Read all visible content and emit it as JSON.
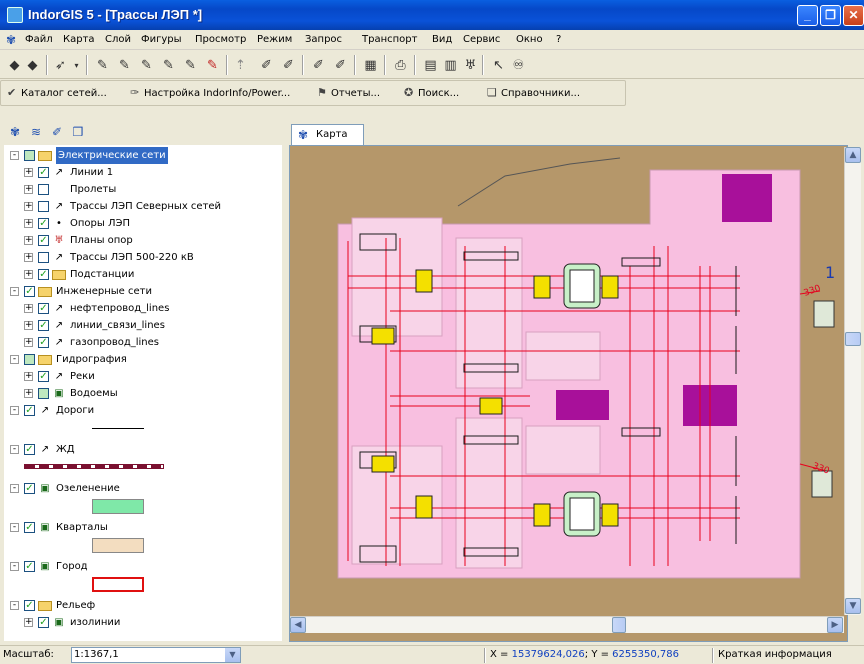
{
  "window": {
    "title": "IndorGIS 5 - [Трассы ЛЭП *]",
    "minimize": "_",
    "restore": "❐",
    "close": "✕"
  },
  "menu": [
    "Файл",
    "Карта",
    "Слой",
    "Фигуры",
    "Просмотр",
    "Режим",
    "Запрос",
    "Транспорт",
    "Вид",
    "Сервис",
    "Окно",
    "?"
  ],
  "mdi_controls": {
    "minimize": "_",
    "restore": "❐",
    "close": "✕"
  },
  "toolbar2": [
    {
      "label": "Каталог сетей...",
      "icon": "checkmark-icon"
    },
    {
      "label": "Настройка IndorInfo/Power...",
      "icon": "wrench-icon"
    },
    {
      "label": "Отчеты...",
      "icon": "report-icon"
    },
    {
      "label": "Поиск...",
      "icon": "search-icon"
    },
    {
      "label": "Справочники...",
      "icon": "book-icon"
    }
  ],
  "map_tab": "Карта",
  "tree": [
    {
      "label": "Электрические сети",
      "level": 0,
      "type": "folder",
      "expand": "-",
      "check": "partial",
      "selected": true
    },
    {
      "label": "Линии 1",
      "level": 1,
      "type": "line",
      "expand": "+",
      "check": "checked"
    },
    {
      "label": "Пролеты",
      "level": 1,
      "type": "none",
      "expand": "+",
      "check": "unchecked"
    },
    {
      "label": "Трассы ЛЭП Северных сетей",
      "level": 1,
      "type": "line",
      "expand": "+",
      "check": "unchecked"
    },
    {
      "label": "Опоры ЛЭП",
      "level": 1,
      "type": "point",
      "expand": "+",
      "check": "checked"
    },
    {
      "label": "Планы опор",
      "level": 1,
      "type": "tower",
      "expand": "+",
      "check": "checked"
    },
    {
      "label": "Трассы ЛЭП 500-220 кВ",
      "level": 1,
      "type": "line",
      "expand": "+",
      "check": "unchecked"
    },
    {
      "label": "Подстанции",
      "level": 1,
      "type": "folder",
      "expand": "+",
      "check": "checked"
    },
    {
      "label": "Инженерные сети",
      "level": 0,
      "type": "folder",
      "expand": "-",
      "check": "checked"
    },
    {
      "label": "нефтепровод_lines",
      "level": 1,
      "type": "line",
      "expand": "+",
      "check": "checked"
    },
    {
      "label": "линии_связи_lines",
      "level": 1,
      "type": "line",
      "expand": "+",
      "check": "checked"
    },
    {
      "label": "газопровод_lines",
      "level": 1,
      "type": "line",
      "expand": "+",
      "check": "checked"
    },
    {
      "label": "Гидрография",
      "level": 0,
      "type": "folder",
      "expand": "-",
      "check": "partial"
    },
    {
      "label": "Реки",
      "level": 1,
      "type": "line",
      "expand": "+",
      "check": "checked"
    },
    {
      "label": "Водоемы",
      "level": 1,
      "type": "poly",
      "expand": "+",
      "check": "partial"
    },
    {
      "label": "Дороги",
      "level": 0,
      "type": "line",
      "expand": "-",
      "check": "checked",
      "swatch": {
        "kind": "line",
        "color": "#000000"
      }
    },
    {
      "label": "ЖД",
      "level": 0,
      "type": "line",
      "expand": "-",
      "check": "checked",
      "swatch": {
        "kind": "rail",
        "color": "#7a1030"
      }
    },
    {
      "label": "Озеленение",
      "level": 0,
      "type": "poly",
      "expand": "-",
      "check": "checked",
      "swatch": {
        "kind": "fill",
        "color": "#7fe8a8"
      }
    },
    {
      "label": "Кварталы",
      "level": 0,
      "type": "poly",
      "expand": "-",
      "check": "checked",
      "swatch": {
        "kind": "fill",
        "color": "#f3ddc0"
      }
    },
    {
      "label": "Город",
      "level": 0,
      "type": "poly",
      "expand": "-",
      "check": "checked",
      "swatch": {
        "kind": "outline",
        "color": "#e01010"
      }
    },
    {
      "label": "Рельеф",
      "level": 0,
      "type": "folder",
      "expand": "-",
      "check": "checked"
    },
    {
      "label": "изолинии",
      "level": 1,
      "type": "poly",
      "expand": "+",
      "check": "checked"
    }
  ],
  "status": {
    "scale_label": "Масштаб:",
    "scale_value": "1:1367,1",
    "x_label": "X = ",
    "x_value": "15379624,026",
    "y_label": "; Y = ",
    "y_value": "6255350,786",
    "info": "Краткая информация"
  },
  "map_labels": {
    "label1": "1",
    "label2": "330",
    "label3": "330"
  },
  "colors": {
    "terrain": "#b5976a",
    "site": "#f8bfe0",
    "building": "#a8109a",
    "cable": "#e8001c",
    "yard": "#f8d4e8"
  }
}
